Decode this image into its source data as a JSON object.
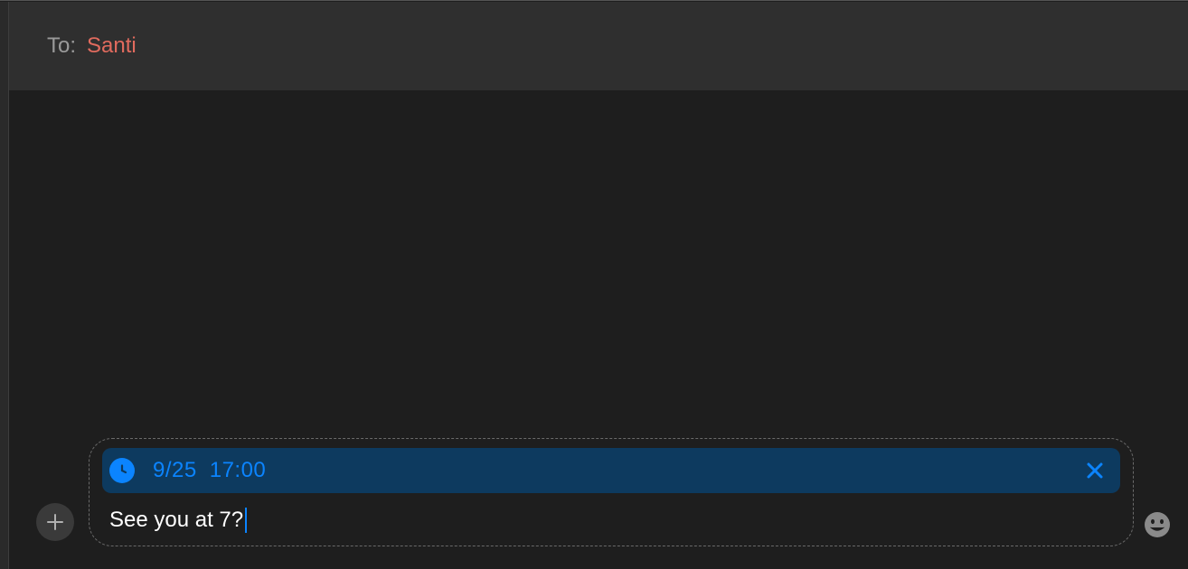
{
  "header": {
    "to_label": "To:",
    "to_value": "Santi"
  },
  "compose": {
    "scheduled": {
      "date": "9/25",
      "time": "17:00"
    },
    "message_text": "See you at 7?"
  },
  "icons": {
    "plus": "plus-icon",
    "clock": "clock-icon",
    "close": "close-icon",
    "emoji": "emoji-icon"
  },
  "colors": {
    "accent_blue": "#0b84ff",
    "scheduled_bg": "#0d3a5f",
    "recipient_red": "#e16b5e",
    "header_bg": "#2f2f2f",
    "body_bg": "#1e1e1e"
  }
}
